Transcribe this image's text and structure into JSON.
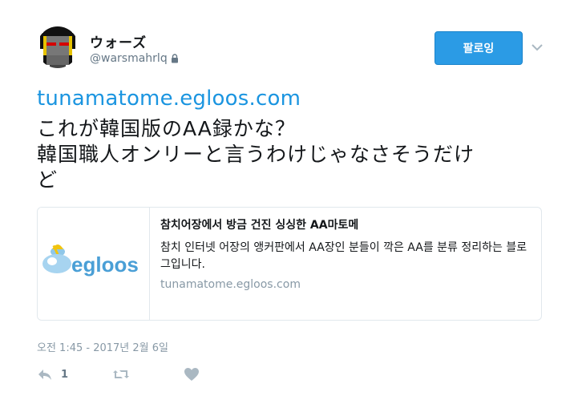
{
  "user": {
    "display_name": "ウォーズ",
    "handle": "@warsmahrlq",
    "avatar_icon": "pixel-robot-avatar-icon",
    "protected_icon": "lock-icon"
  },
  "follow_button": {
    "label": "팔로잉"
  },
  "menu_icon": "chevron-down-icon",
  "tweet": {
    "link_text": "tunamatome.egloos.com",
    "lines": [
      "これが韓国版のAA録かな？",
      "韓国職人オンリーと言うわけじゃなさそうだけ",
      "ど"
    ]
  },
  "card": {
    "image_alt_icon": "egloos-logo-icon",
    "logo_text": "egloos",
    "title": "참치어장에서 방금 건진 싱싱한 AA마토메",
    "description": "참치 인터넷 어장의 앵커판에서 AA장인 분들이 깍은 AA를 분류 정리하는 블로그입니다.",
    "domain": "tunamatome.egloos.com"
  },
  "timestamp": "오전 1:45 - 2017년 2월 6일",
  "actions": {
    "reply_icon": "reply-icon",
    "reply_count": "1",
    "retweet_icon": "retweet-icon",
    "like_icon": "heart-icon"
  },
  "colors": {
    "accent": "#1b95e0",
    "button": "#2b9be5",
    "muted": "#8899a6"
  }
}
